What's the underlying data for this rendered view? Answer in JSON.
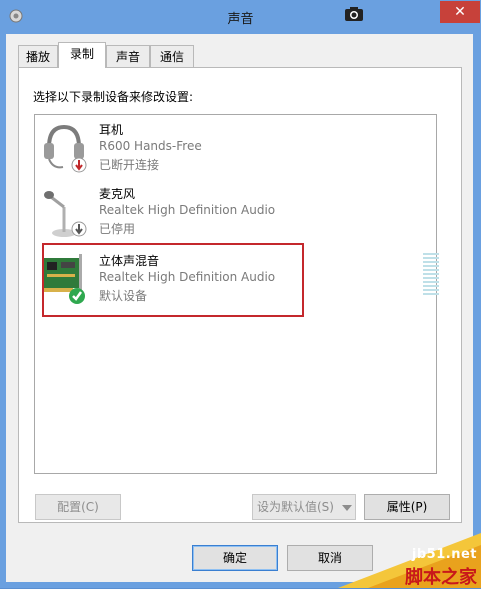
{
  "window": {
    "title": "声音",
    "close_label": "✕"
  },
  "tabs": [
    {
      "label": "播放",
      "active": false
    },
    {
      "label": "录制",
      "active": true
    },
    {
      "label": "声音",
      "active": false
    },
    {
      "label": "通信",
      "active": false
    }
  ],
  "panel": {
    "instruction": "选择以下录制设备来修改设置:"
  },
  "devices": [
    {
      "name": "耳机",
      "driver": "R600 Hands-Free",
      "status": "已断开连接",
      "icon": "headset-icon",
      "badge": "disconnected-badge"
    },
    {
      "name": "麦克风",
      "driver": "Realtek High Definition Audio",
      "status": "已停用",
      "icon": "microphone-icon",
      "badge": "disabled-badge"
    },
    {
      "name": "立体声混音",
      "driver": "Realtek High Definition Audio",
      "status": "默认设备",
      "icon": "sound-card-icon",
      "badge": "default-check-badge",
      "selected": true
    }
  ],
  "buttons": {
    "configure": "配置(C)",
    "set_default": "设为默认值(S)",
    "properties": "属性(P)",
    "ok": "确定",
    "cancel": "取消"
  },
  "watermark": {
    "url": "jb51.net",
    "text": "脚本之家"
  },
  "colors": {
    "title_bar": "#6aa0e0",
    "close_button": "#c7413a",
    "selection_border": "#c4282c",
    "default_check": "#2fa84f"
  }
}
